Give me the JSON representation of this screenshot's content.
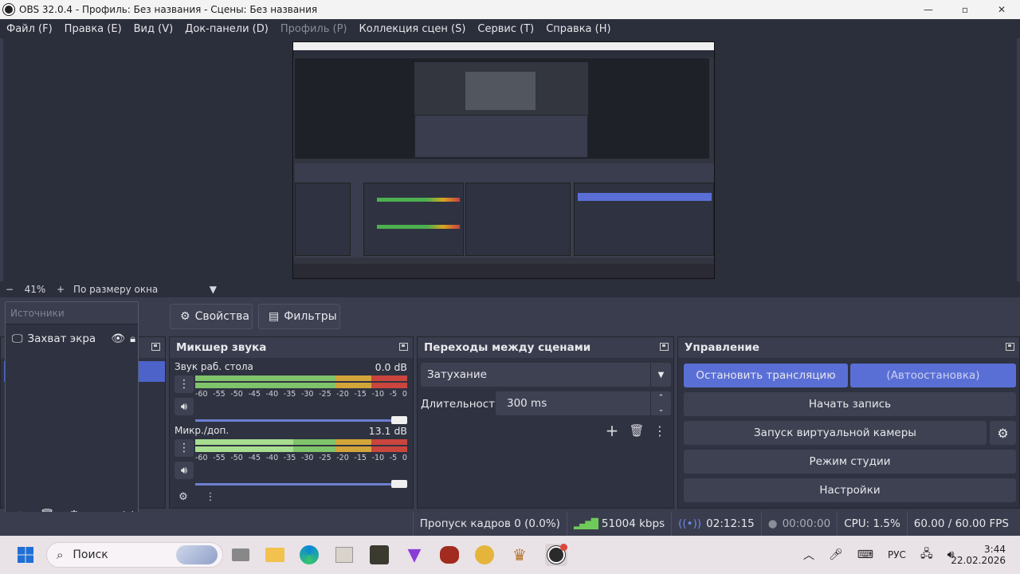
{
  "window": {
    "title": "OBS 32.0.4 - Профиль: Без названия - Сцены: Без названия",
    "controls": {
      "minimize": "—",
      "maximize": "▫",
      "close": "✕"
    }
  },
  "menu": [
    {
      "label": "Файл (F)",
      "enabled": true
    },
    {
      "label": "Правка (E)",
      "enabled": true
    },
    {
      "label": "Вид (V)",
      "enabled": true
    },
    {
      "label": "Док-панели (D)",
      "enabled": true
    },
    {
      "label": "Профиль (P)",
      "enabled": false
    },
    {
      "label": "Коллекция сцен (S)",
      "enabled": true
    },
    {
      "label": "Сервис (T)",
      "enabled": true
    },
    {
      "label": "Справка (H)",
      "enabled": true
    }
  ],
  "zoom": {
    "minus": "−",
    "value": "41%",
    "plus": "+",
    "mode": "По размеру окна"
  },
  "toolbar": {
    "properties_label": "Свойства",
    "filters_label": "Фильтры"
  },
  "sources": {
    "title": "Источники",
    "items": [
      {
        "name": "Захват экра",
        "visible": true,
        "locked": true
      }
    ]
  },
  "mixer": {
    "title": "Микшер звука",
    "scale": [
      "-60",
      "-55",
      "-50",
      "-45",
      "-40",
      "-35",
      "-30",
      "-25",
      "-20",
      "-15",
      "-10",
      "-5",
      "0"
    ],
    "channels": [
      {
        "name": "Звук раб. стола",
        "db": "0.0 dB",
        "level_fraction": 0.67,
        "volume_fraction": 1.0
      },
      {
        "name": "Микр./доп.",
        "db": "13.1 dB",
        "level_fraction": 0.5,
        "volume_fraction": 1.0
      }
    ]
  },
  "transitions": {
    "title": "Переходы между сценами",
    "selected": "Затухание",
    "duration_label": "Длительность",
    "duration_value": "300 ms"
  },
  "controls": {
    "title": "Управление",
    "stop_stream": "Остановить трансляцию",
    "auto_stop": "(Автоостановка)",
    "start_record": "Начать запись",
    "virtual_cam": "Запуск виртуальной камеры",
    "studio_mode": "Режим студии",
    "settings": "Настройки"
  },
  "status": {
    "dropped_frames": "Пропуск кадров 0 (0.0%)",
    "bitrate": "51004 kbps",
    "stream_time": "02:12:15",
    "record_time": "00:00:00",
    "cpu": "CPU: 1.5%",
    "fps": "60.00 / 60.00 FPS"
  },
  "taskbar": {
    "search_placeholder": "Поиск",
    "lang": "РУС",
    "time": "3:44",
    "date": "22.02.2026"
  },
  "colors": {
    "accent": "#5a6fd6",
    "meter_green": "#7fc36a",
    "meter_yellow": "#d2a53a",
    "meter_red": "#c9453e",
    "panel": "#2f3240",
    "background": "#3a3d4d"
  }
}
